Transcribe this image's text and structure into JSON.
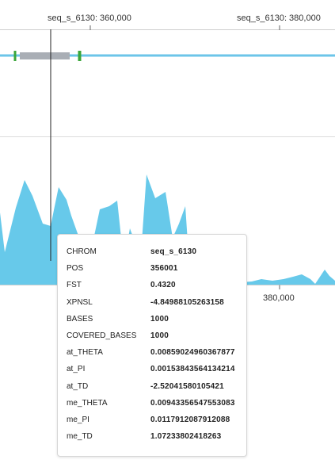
{
  "top_axis": {
    "ticks": [
      {
        "label": "seq_s_6130: 360,000",
        "position": 360000
      },
      {
        "label": "seq_s_6130: 380,000",
        "position": 380000
      }
    ]
  },
  "bottom_axis": {
    "ticks": [
      {
        "label": "380,000",
        "position": 380000
      }
    ]
  },
  "colors": {
    "gene_line": "#6cc5e9",
    "gene_block": "#a9aeb5",
    "exon_marker": "#3aa63a",
    "area_fill": "#67c9ea",
    "cursor": "#222222",
    "divider": "#dcdcdc"
  },
  "tooltip": {
    "rows": [
      {
        "key": "CHROM",
        "value": "seq_s_6130"
      },
      {
        "key": "POS",
        "value": "356001"
      },
      {
        "key": "FST",
        "value": "0.4320"
      },
      {
        "key": "XPNSL",
        "value": "-4.84988105263158"
      },
      {
        "key": "BASES",
        "value": "1000"
      },
      {
        "key": "COVERED_BASES",
        "value": "1000"
      },
      {
        "key": "at_THETA",
        "value": "0.00859024960367877"
      },
      {
        "key": "at_PI",
        "value": "0.00153843564134214"
      },
      {
        "key": "at_TD",
        "value": "-2.52041580105421"
      },
      {
        "key": "me_THETA",
        "value": "0.00943356547553083"
      },
      {
        "key": "me_PI",
        "value": "0.0117912087912088"
      },
      {
        "key": "me_TD",
        "value": "1.07233802418263"
      }
    ]
  }
}
